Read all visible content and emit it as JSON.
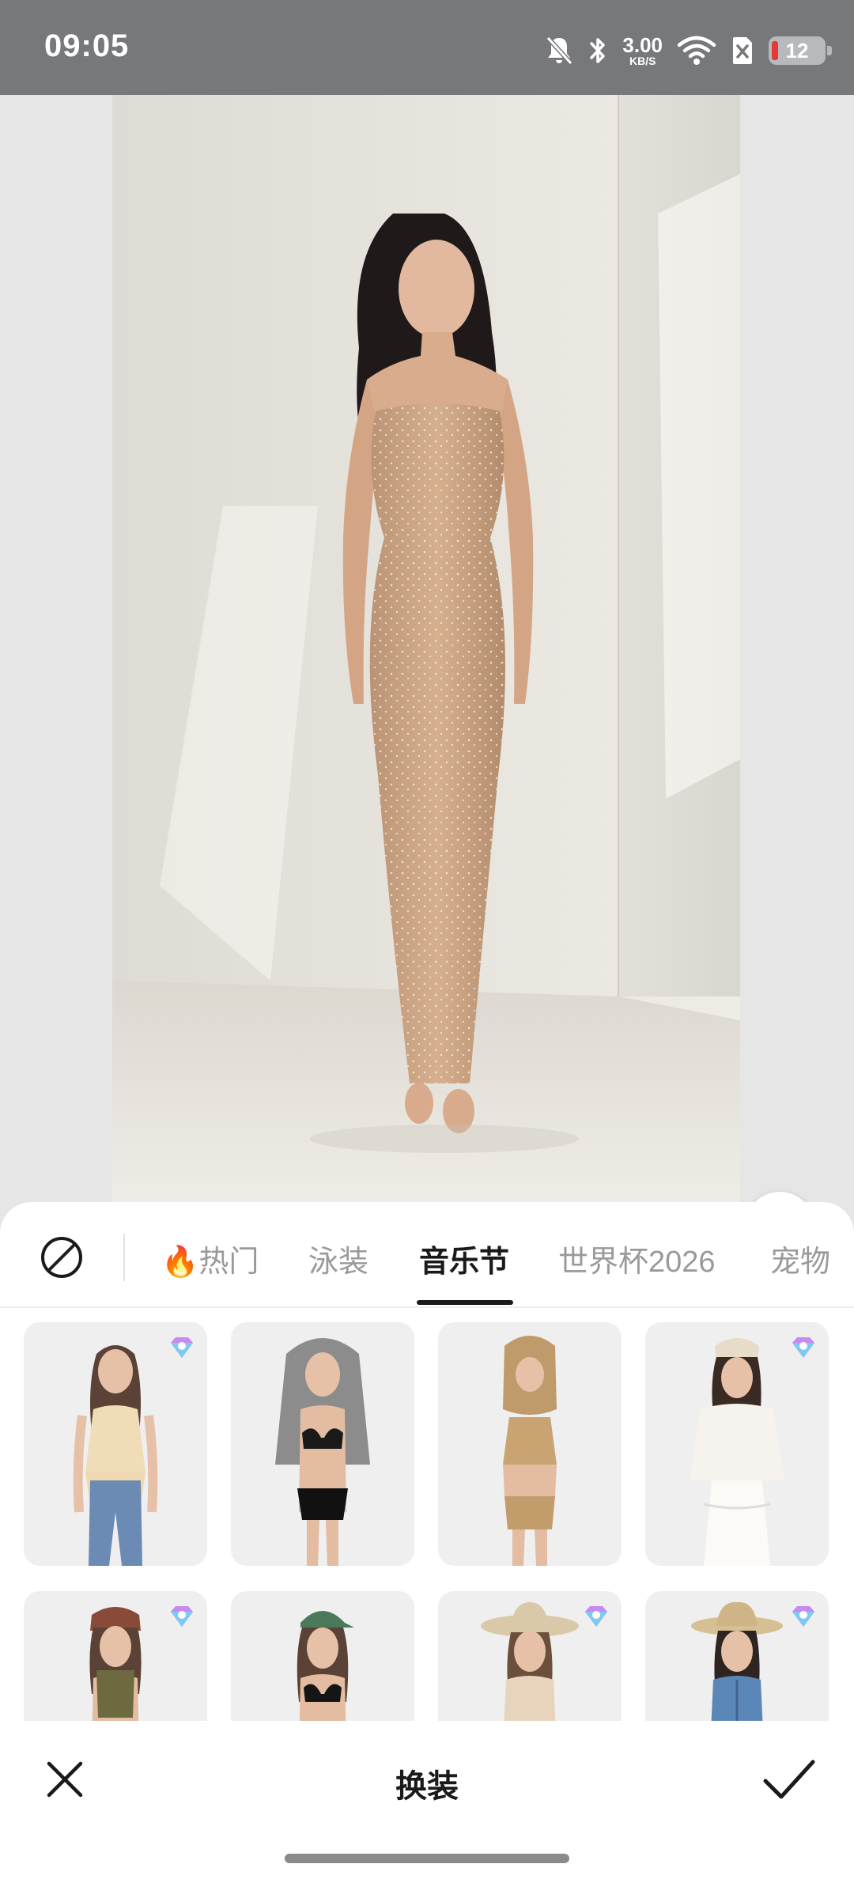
{
  "status_bar": {
    "time": "09:05",
    "net_speed_value": "3.00",
    "net_speed_unit": "KB/S",
    "battery_level": "12",
    "background_color": "#77787c",
    "battery_low_color": "#e53935",
    "icons": [
      "mute-icon",
      "bluetooth-icon",
      "wifi-icon",
      "sim-off-icon",
      "battery-icon"
    ]
  },
  "preview": {
    "compare_icon": "compare-split-icon",
    "eraser_icon": "eraser-icon"
  },
  "category_tabs": {
    "none_icon": "no-effect-icon",
    "items": [
      {
        "label": "🔥热门",
        "active": false
      },
      {
        "label": "泳装",
        "active": false
      },
      {
        "label": "音乐节",
        "active": true
      },
      {
        "label": "世界杯2026",
        "active": false
      },
      {
        "label": "宠物",
        "active": false
      }
    ]
  },
  "outfits": [
    {
      "name": "outfit-card-cream-ruffle-top-jeans",
      "premium": true
    },
    {
      "name": "outfit-card-sequin-veil-bikini",
      "premium": false
    },
    {
      "name": "outfit-card-crochet-hood-set",
      "premium": false
    },
    {
      "name": "outfit-card-white-lace-headscarf",
      "premium": true
    },
    {
      "name": "outfit-card-bandana-floral-top",
      "premium": true
    },
    {
      "name": "outfit-card-green-cap-bikini",
      "premium": false
    },
    {
      "name": "outfit-card-straw-hat-beige-top",
      "premium": true
    },
    {
      "name": "outfit-card-cowboy-hat-denim-vest",
      "premium": true
    }
  ],
  "action_bar": {
    "close_icon": "close-icon",
    "title": "换装",
    "confirm_icon": "check-icon"
  }
}
